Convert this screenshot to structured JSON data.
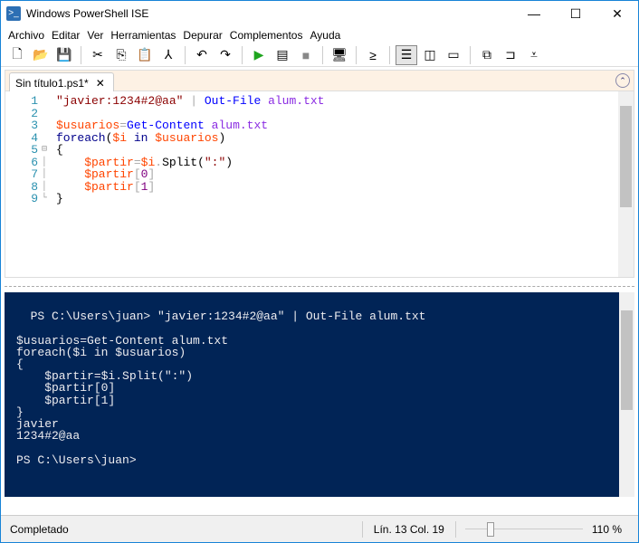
{
  "window": {
    "title": "Windows PowerShell ISE",
    "icon": "powershell-icon",
    "minimize": "—",
    "maximize": "☐",
    "close": "✕"
  },
  "menu": [
    {
      "label": "Archivo"
    },
    {
      "label": "Editar"
    },
    {
      "label": "Ver"
    },
    {
      "label": "Herramientas"
    },
    {
      "label": "Depurar"
    },
    {
      "label": "Complementos"
    },
    {
      "label": "Ayuda"
    }
  ],
  "toolbar": [
    {
      "name": "new-icon",
      "glyph": "🗋"
    },
    {
      "name": "open-icon",
      "glyph": "📂"
    },
    {
      "name": "save-icon",
      "glyph": "💾"
    },
    "sep",
    {
      "name": "cut-icon",
      "glyph": "✂"
    },
    {
      "name": "copy-icon",
      "glyph": "⎘"
    },
    {
      "name": "paste-icon",
      "glyph": "📋"
    },
    {
      "name": "clear-console-icon",
      "glyph": "⅄"
    },
    "sep",
    {
      "name": "undo-icon",
      "glyph": "↶"
    },
    {
      "name": "redo-icon",
      "glyph": "↷"
    },
    "sep",
    {
      "name": "run-icon",
      "glyph": "▶"
    },
    {
      "name": "run-selection-icon",
      "glyph": "▤"
    },
    {
      "name": "stop-icon",
      "glyph": "■"
    },
    "sep",
    {
      "name": "remote-powershell-icon",
      "glyph": "🖥"
    },
    "sep",
    {
      "name": "start-powershell-icon",
      "glyph": "≥"
    },
    "sep",
    {
      "name": "show-script-top-icon",
      "glyph": "☰"
    },
    {
      "name": "show-script-right-icon",
      "glyph": "◫"
    },
    {
      "name": "show-script-max-icon",
      "glyph": "▭"
    },
    "sep",
    {
      "name": "show-commands-icon",
      "glyph": "⧉"
    },
    {
      "name": "show-addon-icon",
      "glyph": "⊐"
    },
    {
      "name": "toolbar-overflow-icon",
      "glyph": "⩡"
    }
  ],
  "tab": {
    "label": "Sin título1.ps1*",
    "close": "✕"
  },
  "editor": {
    "lines": [
      {
        "n": "1",
        "fold": "",
        "tokens": [
          {
            "t": "\"javier:1234#2@aa\"",
            "c": "str"
          },
          {
            "t": " | ",
            "c": "op"
          },
          {
            "t": "Out-File",
            "c": "cmd"
          },
          {
            "t": " alum.txt",
            "c": "arg"
          }
        ]
      },
      {
        "n": "2",
        "fold": "",
        "tokens": []
      },
      {
        "n": "3",
        "fold": "",
        "tokens": [
          {
            "t": "$usuarios",
            "c": "var"
          },
          {
            "t": "=",
            "c": "op"
          },
          {
            "t": "Get-Content",
            "c": "cmd"
          },
          {
            "t": " alum.txt",
            "c": "arg"
          }
        ]
      },
      {
        "n": "4",
        "fold": "",
        "tokens": [
          {
            "t": "foreach",
            "c": "kw"
          },
          {
            "t": "(",
            "c": "txt"
          },
          {
            "t": "$i",
            "c": "var"
          },
          {
            "t": " in ",
            "c": "kw"
          },
          {
            "t": "$usuarios",
            "c": "var"
          },
          {
            "t": ")",
            "c": "txt"
          }
        ]
      },
      {
        "n": "5",
        "fold": "⊟",
        "tokens": [
          {
            "t": "{",
            "c": "txt"
          }
        ]
      },
      {
        "n": "6",
        "fold": "│",
        "tokens": [
          {
            "t": "    $partir",
            "c": "var"
          },
          {
            "t": "=",
            "c": "op"
          },
          {
            "t": "$i",
            "c": "var"
          },
          {
            "t": ".",
            "c": "op"
          },
          {
            "t": "Split(",
            "c": "txt"
          },
          {
            "t": "\":\"",
            "c": "str"
          },
          {
            "t": ")",
            "c": "txt"
          }
        ]
      },
      {
        "n": "7",
        "fold": "│",
        "tokens": [
          {
            "t": "    $partir",
            "c": "var"
          },
          {
            "t": "[",
            "c": "op"
          },
          {
            "t": "0",
            "c": "num"
          },
          {
            "t": "]",
            "c": "op"
          }
        ]
      },
      {
        "n": "8",
        "fold": "│",
        "tokens": [
          {
            "t": "    $partir",
            "c": "var"
          },
          {
            "t": "[",
            "c": "op"
          },
          {
            "t": "1",
            "c": "num"
          },
          {
            "t": "]",
            "c": "op"
          }
        ]
      },
      {
        "n": "9",
        "fold": "└",
        "tokens": [
          {
            "t": "}",
            "c": "txt"
          }
        ]
      }
    ]
  },
  "console": {
    "text": "PS C:\\Users\\juan> \"javier:1234#2@aa\" | Out-File alum.txt\n\n$usuarios=Get-Content alum.txt\nforeach($i in $usuarios)\n{\n    $partir=$i.Split(\":\")\n    $partir[0]\n    $partir[1]\n}\njavier\n1234#2@aa\n\nPS C:\\Users\\juan>"
  },
  "status": {
    "text": "Completado",
    "position": "Lín. 13  Col. 19",
    "zoom": "110 %",
    "zoom_slider_percent": 20
  }
}
